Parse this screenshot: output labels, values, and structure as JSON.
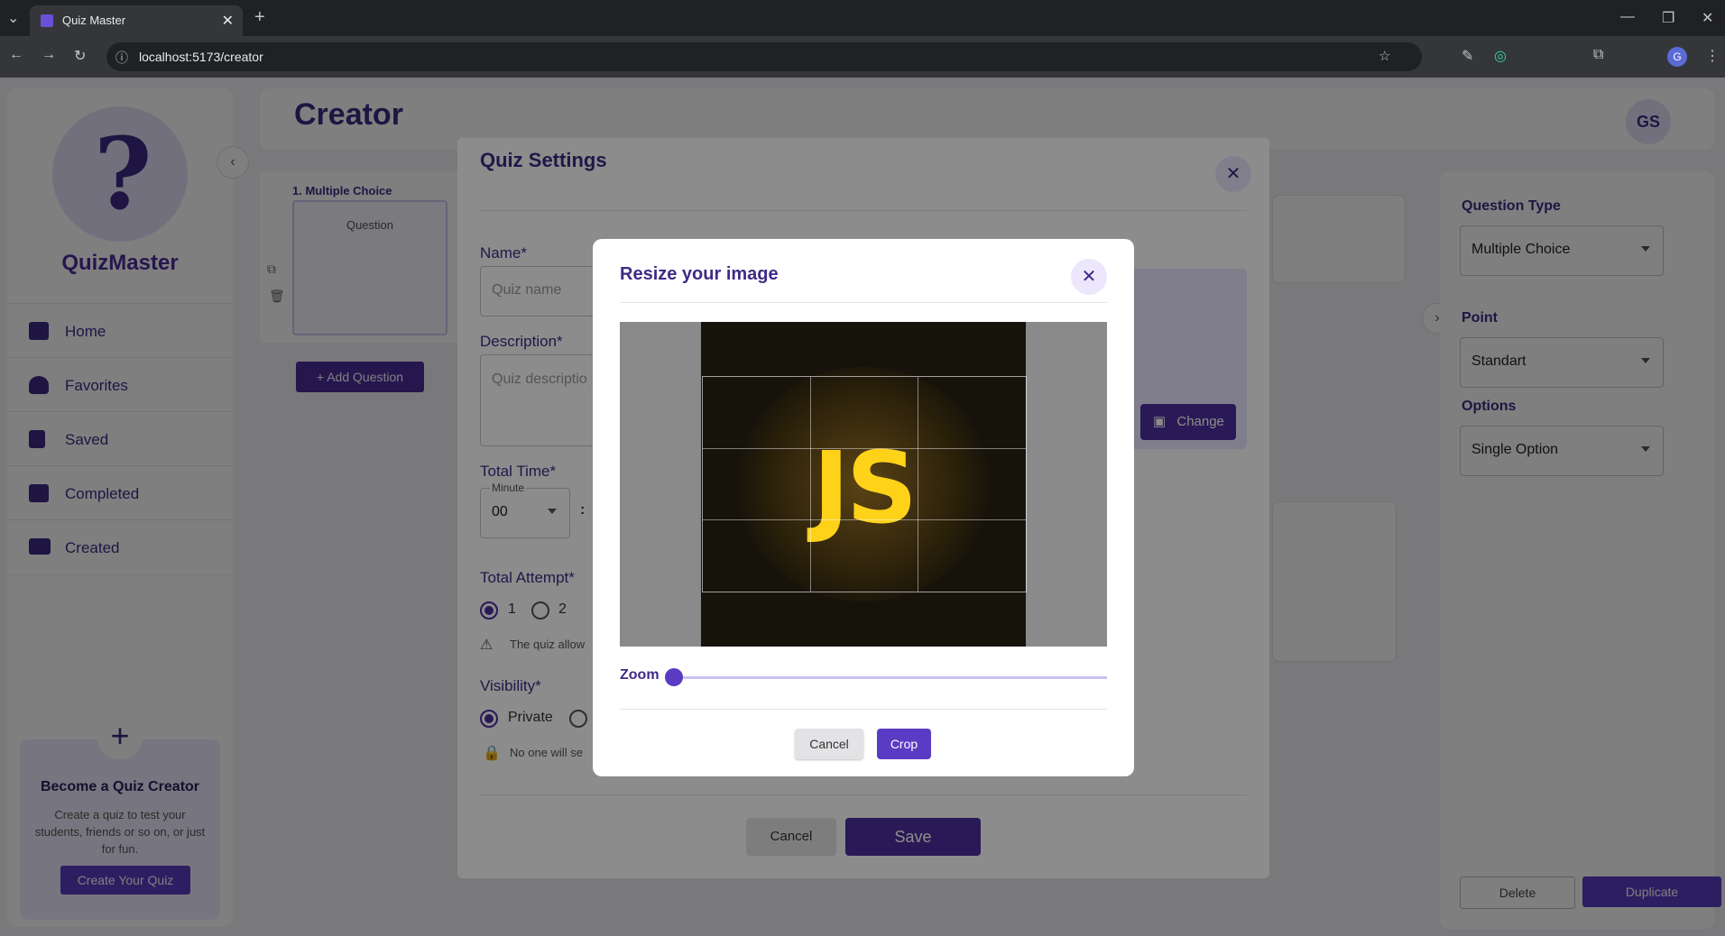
{
  "browser": {
    "tab_title": "Quiz Master",
    "tab_close": "✕",
    "new_tab": "+",
    "url": "localhost:5173/creator",
    "profile_initial": "G"
  },
  "sidebar": {
    "brand": "QuizMaster",
    "items": [
      {
        "label": "Home",
        "icon": "home-icon"
      },
      {
        "label": "Favorites",
        "icon": "heart-icon"
      },
      {
        "label": "Saved",
        "icon": "bookmark-icon"
      },
      {
        "label": "Completed",
        "icon": "clipboard-check-icon"
      },
      {
        "label": "Created",
        "icon": "folder-icon"
      }
    ],
    "promo": {
      "plus": "+",
      "title": "Become a Quiz Creator",
      "text": "Create a quiz to test your students, friends or so on, or just for fun.",
      "button": "Create Your Quiz"
    }
  },
  "header": {
    "title": "Creator",
    "avatar": "GS"
  },
  "question_list": {
    "item_title": "1. Multiple Choice",
    "card_label": "Question",
    "add_button": "Add Question"
  },
  "right_panel": {
    "question_type_label": "Question Type",
    "question_type_value": "Multiple Choice",
    "point_label": "Point",
    "point_value": "Standart",
    "options_label": "Options",
    "options_value": "Single Option",
    "delete_button": "Delete",
    "duplicate_button": "Duplicate"
  },
  "quiz_settings": {
    "title": "Quiz Settings",
    "name_label": "Name*",
    "name_placeholder": "Quiz name",
    "description_label": "Description*",
    "description_placeholder": "Quiz descriptio",
    "total_time_label": "Total Time*",
    "minute_label": "Minute",
    "minute_value": "00",
    "colon": ":",
    "total_attempt_label": "Total Attempt*",
    "attempt_options": [
      "1",
      "2"
    ],
    "attempt_note": "The quiz allow",
    "visibility_label": "Visibility*",
    "visibility_option": "Private",
    "visibility_note": "No one will se",
    "change_button": "Change",
    "cancel_button": "Cancel",
    "save_button": "Save"
  },
  "resize_modal": {
    "title": "Resize your image",
    "image_text": "JS",
    "zoom_label": "Zoom",
    "zoom_value": 0,
    "cancel_button": "Cancel",
    "crop_button": "Crop"
  },
  "colors": {
    "accent": "#5a3cc4",
    "brand": "#3f2a86"
  }
}
